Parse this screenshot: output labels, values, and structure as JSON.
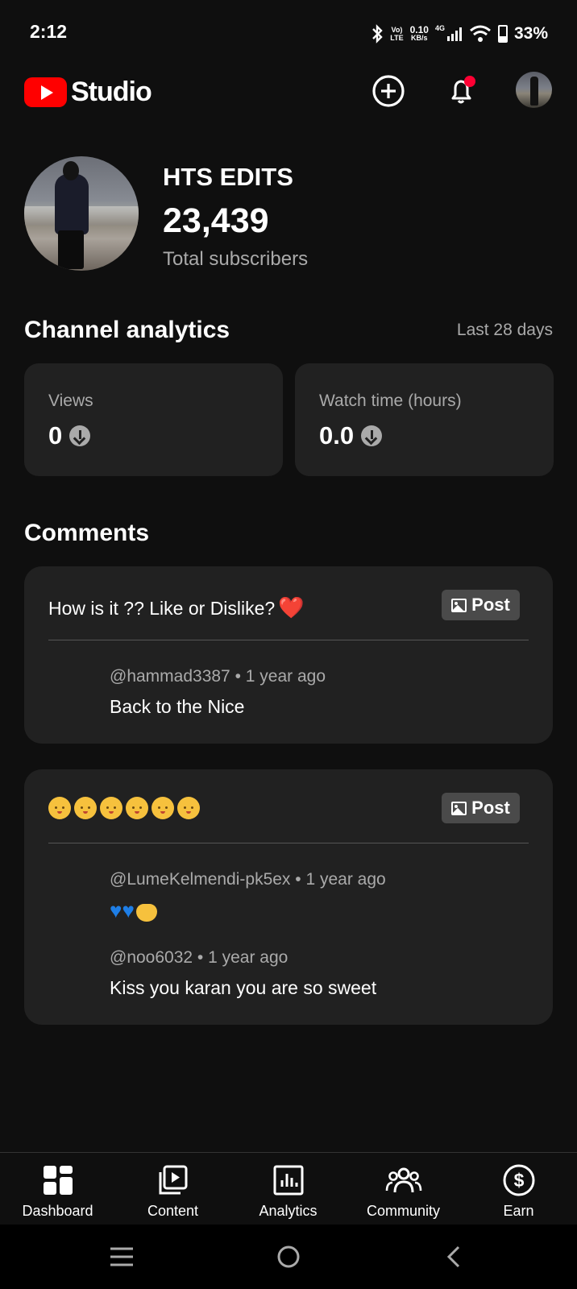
{
  "status_bar": {
    "time": "2:12",
    "volte": "Vo)",
    "lte": "LTE",
    "speed_value": "0.10",
    "speed_unit": "KB/s",
    "network": "4G",
    "battery": "33%"
  },
  "header": {
    "app_name": "Studio",
    "icons": [
      "create-icon",
      "notifications-icon",
      "account-avatar"
    ]
  },
  "channel": {
    "name": "HTS EDITS",
    "subscribers": "23,439",
    "subscribers_label": "Total subscribers"
  },
  "analytics": {
    "title": "Channel analytics",
    "range": "Last 28 days",
    "cards": [
      {
        "label": "Views",
        "value": "0",
        "trend": "down"
      },
      {
        "label": "Watch time (hours)",
        "value": "0.0",
        "trend": "down"
      }
    ]
  },
  "comments": {
    "title": "Comments",
    "post_label": "Post",
    "threads": [
      {
        "post_text": "How is it ?? Like or Dislike?",
        "post_emoji": "❤️",
        "replies": [
          {
            "author": "@hammad3387",
            "age": "1 year ago",
            "text": "Back to the Nice"
          }
        ]
      },
      {
        "post_text": "👶👶👶👶👶👶",
        "replies": [
          {
            "author": "@LumeKelmendi-pk5ex",
            "age": "1 year ago",
            "text": "💙💙🤲"
          },
          {
            "author": "@noo6032",
            "age": "1 year ago",
            "text": "Kiss you karan you are so sweet"
          }
        ]
      }
    ]
  },
  "bottom_nav": {
    "items": [
      "Dashboard",
      "Content",
      "Analytics",
      "Community",
      "Earn"
    ]
  },
  "colors": {
    "background": "#0f0f0f",
    "card": "#212121",
    "brand_red": "#ff0000",
    "secondary_text": "#aaaaaa"
  }
}
